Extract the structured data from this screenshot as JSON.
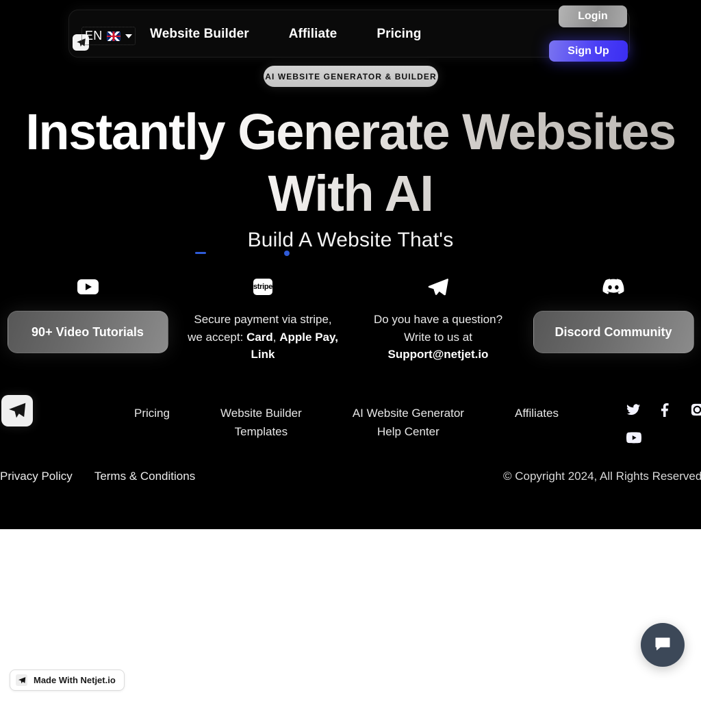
{
  "navbar": {
    "logo_icon": "paper-plane-logo-icon",
    "language": {
      "code": "EN",
      "flag": "uk-flag-icon",
      "caret": "chevron-down-icon"
    },
    "links": [
      {
        "label": "Website Builder"
      },
      {
        "label": "Affiliate"
      },
      {
        "label": "Pricing"
      }
    ],
    "login_label": "Login",
    "signup_label": "Sign Up"
  },
  "hero": {
    "badge": "AI WEBSITE GENERATOR & BUILDER",
    "title": "Instantly Generate Websites With AI",
    "subtitle": "Build A Website That's",
    "accent_color": "#2f5bd8"
  },
  "features": [
    {
      "icon": "youtube-icon",
      "type": "button",
      "button_label": "90+ Video Tutorials"
    },
    {
      "icon": "stripe-icon",
      "icon_label": "stripe",
      "type": "text",
      "line1": "Secure payment via",
      "line2_pre": "stripe, we accept: ",
      "line2_bold": "Card",
      "line2_post": ",",
      "line3_bold": "Apple Pay, Link"
    },
    {
      "icon": "telegram-icon",
      "type": "text",
      "line1": "Do you have a question?",
      "line2_pre": "Write to us at",
      "line3_bold": "Support@netjet.io"
    },
    {
      "icon": "discord-icon",
      "type": "button",
      "button_label": "Discord Community"
    }
  ],
  "footer": {
    "logo_icon": "paper-plane-logo-icon",
    "columns": [
      {
        "links": [
          "Pricing"
        ]
      },
      {
        "links": [
          "Website Builder",
          "Templates"
        ]
      },
      {
        "links": [
          "AI Website Generator",
          "Help Center"
        ]
      },
      {
        "links": [
          "Affiliates"
        ]
      }
    ],
    "socials": [
      {
        "name": "twitter-icon"
      },
      {
        "name": "facebook-icon"
      },
      {
        "name": "instagram-icon"
      },
      {
        "name": "youtube-icon"
      }
    ],
    "legal": [
      {
        "label": "Privacy Policy"
      },
      {
        "label": "Terms & Conditions"
      }
    ],
    "copyright": "© Copyright 2024, All Rights Reserved"
  },
  "floating": {
    "made_with_label": "Made With Netjet.io",
    "made_with_icon": "paper-plane-logo-icon",
    "chat_icon": "chat-bubble-icon",
    "chat_color": "#3c4858"
  }
}
